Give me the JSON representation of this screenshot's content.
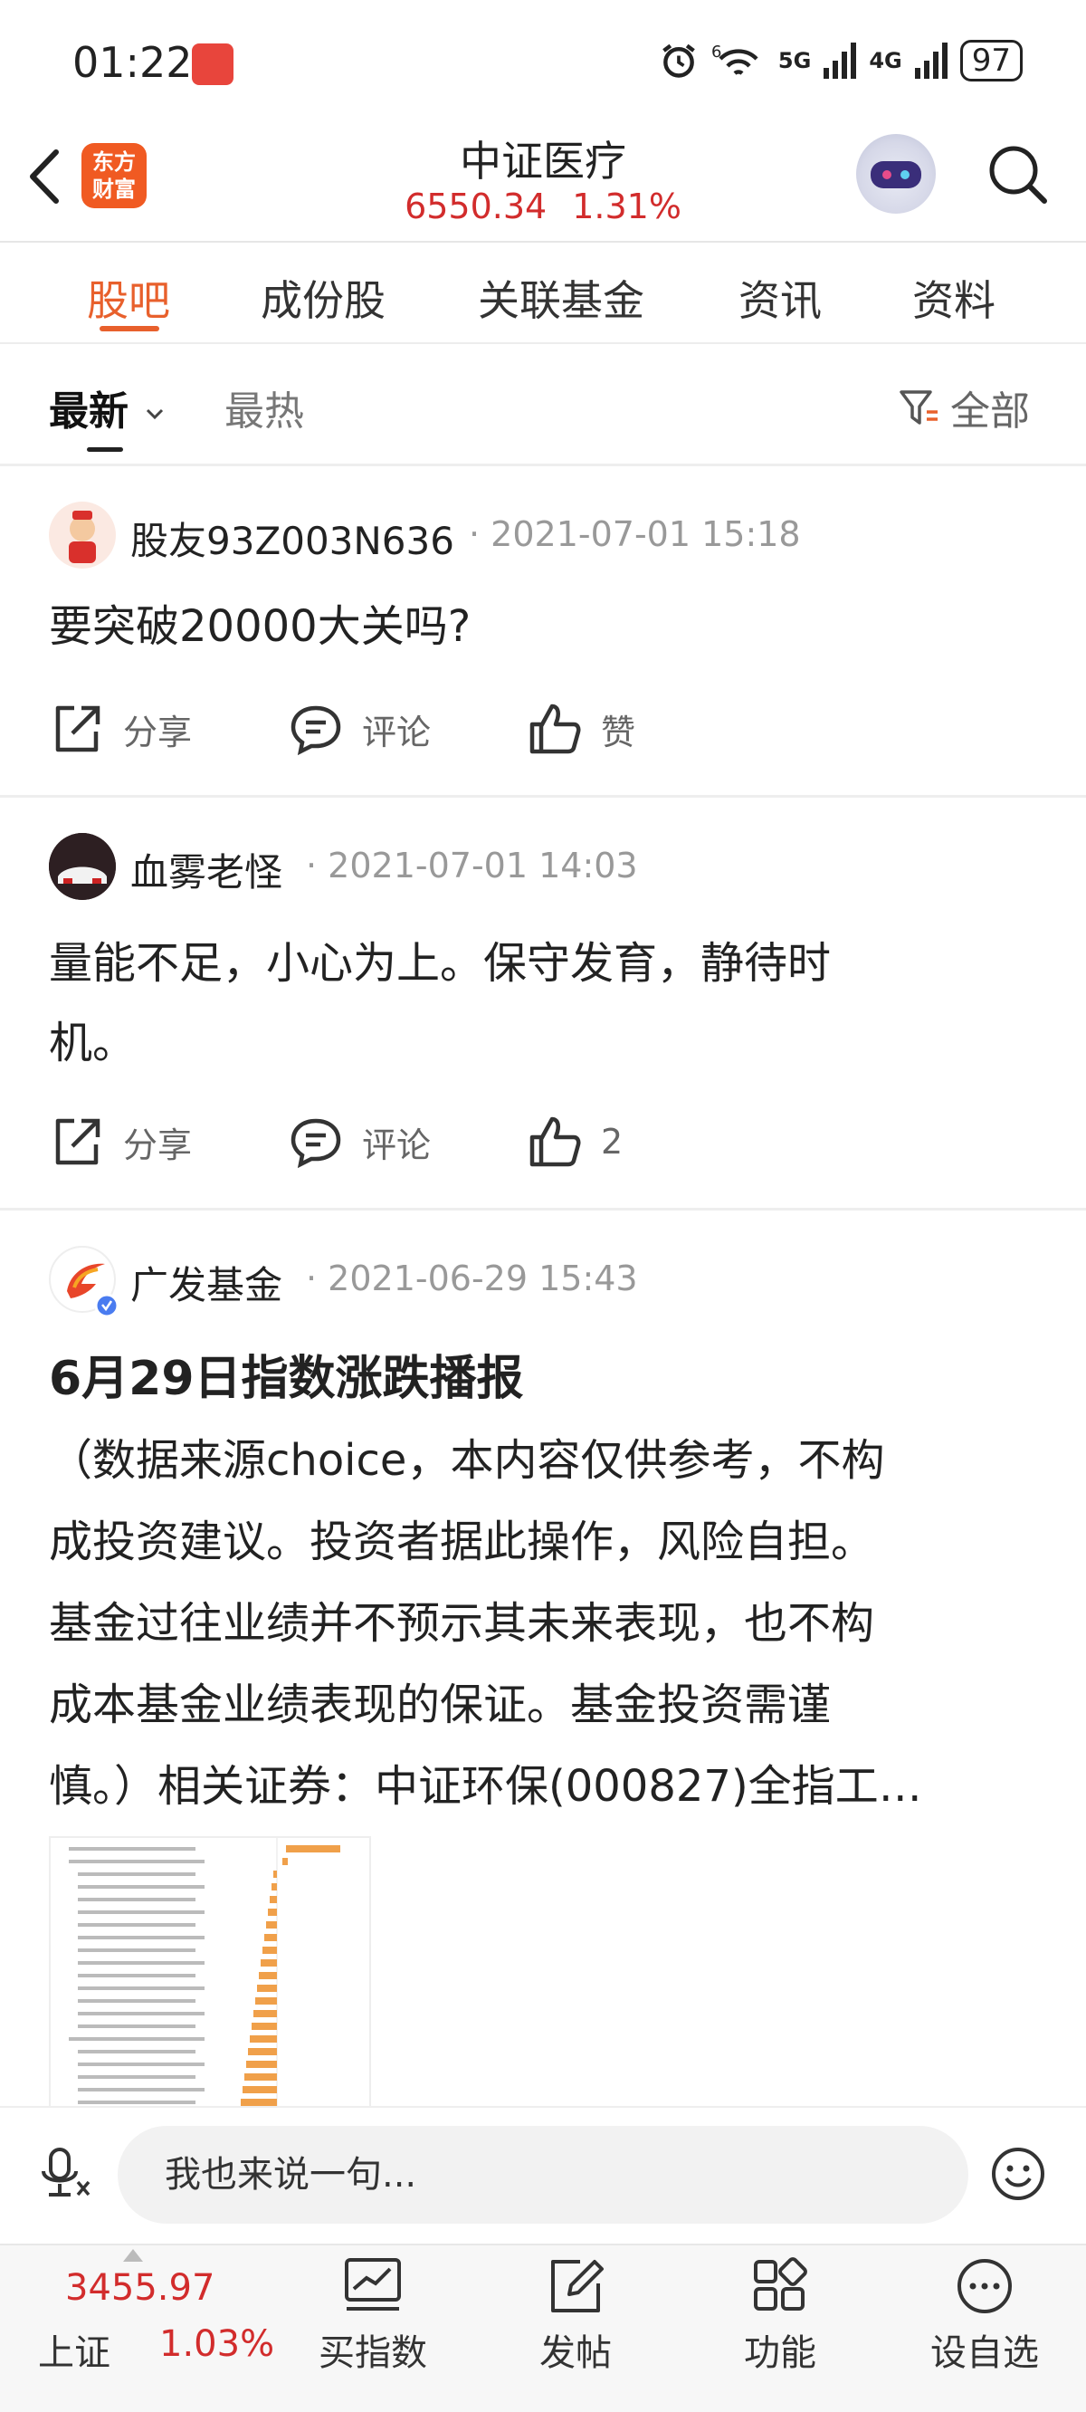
{
  "status_bar": {
    "time": "01:22",
    "signal_labels": [
      "6",
      "5G",
      "4G"
    ],
    "battery": "97"
  },
  "header": {
    "logo_line1": "东方",
    "logo_line2": "财富",
    "title": "中证医疗",
    "index_value": "6550.34",
    "index_change": "1.31%",
    "icons": [
      "back-icon",
      "robot-avatar-icon",
      "search-icon"
    ]
  },
  "tabs": [
    {
      "label": "股吧",
      "active": true
    },
    {
      "label": "成份股"
    },
    {
      "label": "关联基金"
    },
    {
      "label": "资讯"
    },
    {
      "label": "资料"
    }
  ],
  "subfilters": {
    "latest": "最新",
    "hot": "最热",
    "filter_label": "全部"
  },
  "posts": [
    {
      "user": "股友93Z003N636",
      "time": "2021-07-01 15:18",
      "text": "要突破20000大关吗?",
      "share": "分享",
      "comment": "评论",
      "like": "赞"
    },
    {
      "user": "血雾老怪",
      "time": "2021-07-01 14:03",
      "text_line1": "量能不足，小心为上。保守发育，静待时",
      "text_line2": "机。",
      "share": "分享",
      "comment": "评论",
      "like": "2"
    },
    {
      "user": "广发基金",
      "time": "2021-06-29 15:43",
      "title": "6月29日指数涨跌播报",
      "lines": [
        "（数据来源choice，本内容仅供参考，不构",
        "成投资建议。投资者据此操作，风险自担。",
        "基金过往业绩并不预示其未来表现，也不构",
        "成本基金业绩表现的保证。基金投资需谨",
        "慎。）相关证券：中证环保(000827)全指工…"
      ]
    }
  ],
  "composer": {
    "placeholder": "我也来说一句..."
  },
  "bottom_bar": {
    "index_price": "3455.97",
    "index_name": "上证",
    "index_pct": "1.03%",
    "items": [
      "买指数",
      "发帖",
      "功能",
      "设自选"
    ]
  },
  "colors": {
    "accent": "#e8602c",
    "up_red": "#d22c2c",
    "logo_orange": "#f05a22"
  }
}
